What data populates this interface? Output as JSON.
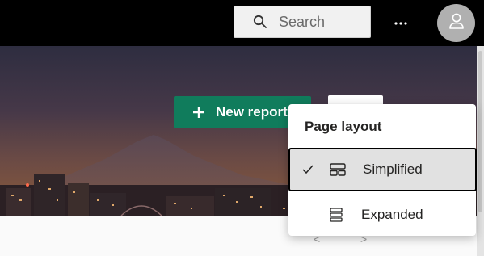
{
  "header": {
    "search_placeholder": "Search",
    "search_icon": "search-icon",
    "more_icon": "more-horizontal-icon",
    "avatar_icon": "user-icon"
  },
  "hero": {
    "new_report_label": "New report",
    "accent_color": "#107c5c"
  },
  "page_layout_menu": {
    "title": "Page layout",
    "items": [
      {
        "label": "Simplified",
        "icon": "simplified-layout-icon",
        "selected": true
      },
      {
        "label": "Expanded",
        "icon": "expanded-layout-icon",
        "selected": false
      }
    ]
  },
  "pager": {
    "prev": "<",
    "next": ">"
  }
}
